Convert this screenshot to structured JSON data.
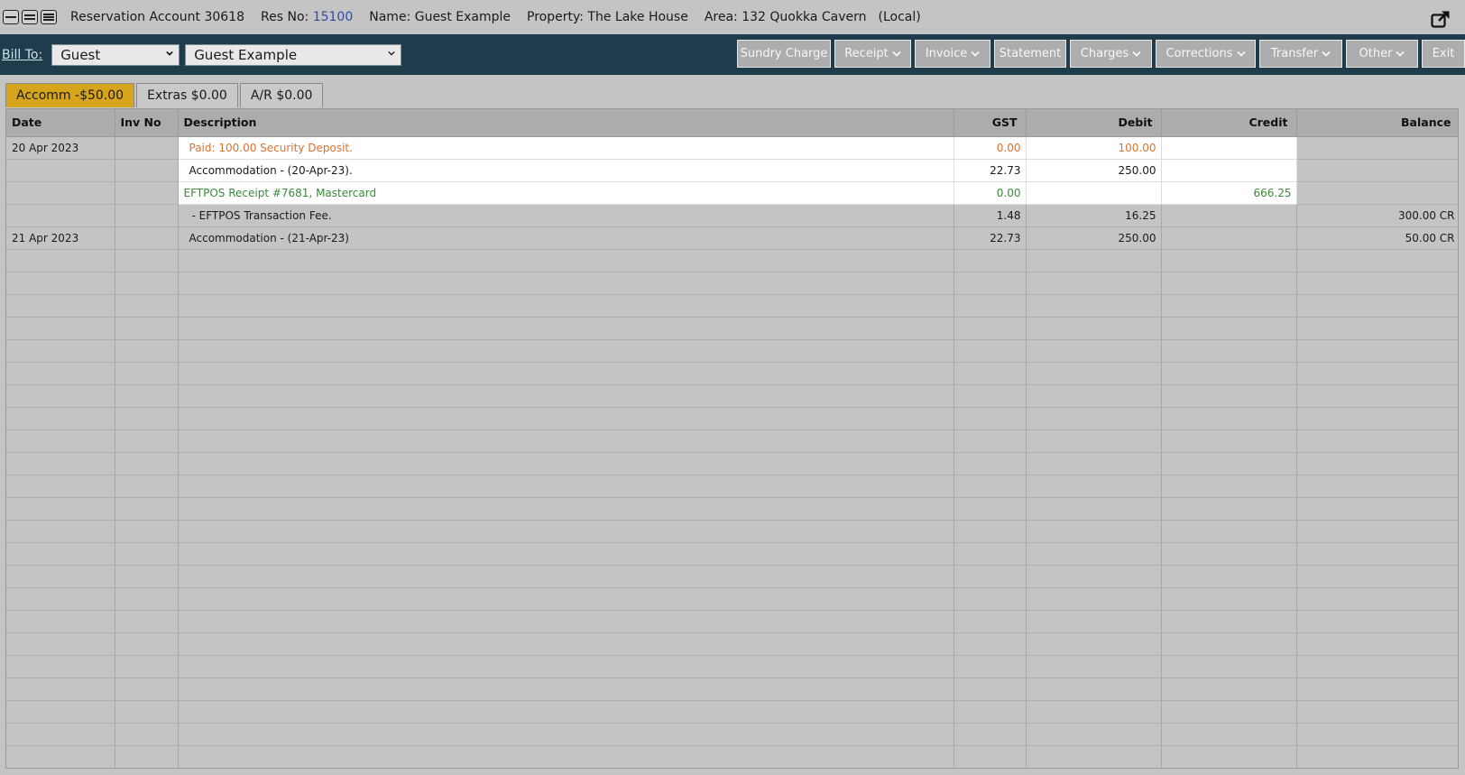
{
  "header": {
    "reservation_account": "Reservation Account 30618",
    "res_no_label": "Res No:",
    "res_no": "15100",
    "name": "Name: Guest Example",
    "property": "Property: The Lake House",
    "area": "Area: 132 Quokka Cavern",
    "location_type": "(Local)",
    "view_buttons": [
      "view-compact-icon",
      "view-medium-icon",
      "view-full-icon"
    ],
    "popout_icon": "popout-window-icon"
  },
  "toolbar": {
    "bill_to_label": "Bill To:",
    "bill_to_type": "Guest",
    "bill_to_name": "Guest Example",
    "buttons": {
      "sundry_charge": "Sundry Charge",
      "receipt": "Receipt",
      "invoice": "Invoice",
      "statement": "Statement",
      "charges": "Charges",
      "corrections": "Corrections",
      "transfer": "Transfer",
      "other": "Other",
      "exit": "Exit"
    }
  },
  "tabs": [
    {
      "label": "Accomm -$50.00",
      "active": true
    },
    {
      "label": "Extras $0.00",
      "active": false
    },
    {
      "label": "A/R $0.00",
      "active": false
    }
  ],
  "table": {
    "columns": [
      "Date",
      "Inv No",
      "Description",
      "GST",
      "Debit",
      "Credit",
      "Balance"
    ],
    "rows": [
      {
        "date": "20 Apr 2023",
        "inv": "",
        "desc": "Paid: 100.00 Security Deposit.",
        "gst": "0.00",
        "debit": "100.00",
        "credit": "",
        "balance": ""
      },
      {
        "date": "",
        "inv": "",
        "desc": "Accommodation  - (20-Apr-23).",
        "gst": "22.73",
        "debit": "250.00",
        "credit": "",
        "balance": ""
      },
      {
        "date": "",
        "inv": "",
        "desc": "EFTPOS Receipt #7681, Mastercard",
        "gst": "0.00",
        "debit": "",
        "credit": "666.25",
        "balance": ""
      },
      {
        "date": "",
        "inv": "",
        "desc": " - EFTPOS Transaction Fee.",
        "gst": "1.48",
        "debit": "16.25",
        "credit": "",
        "balance": "300.00 CR"
      },
      {
        "date": "21 Apr 2023",
        "inv": "",
        "desc": "Accommodation  - (21-Apr-23)",
        "gst": "22.73",
        "debit": "250.00",
        "credit": "",
        "balance": "50.00 CR"
      }
    ]
  },
  "colors": {
    "toolbar_bg": "#1f3c4d",
    "active_tab": "#d7a51b",
    "deposit_text": "#d9722e",
    "receipt_text": "#3a8a3a",
    "res_no_text": "#2e4ca6"
  }
}
